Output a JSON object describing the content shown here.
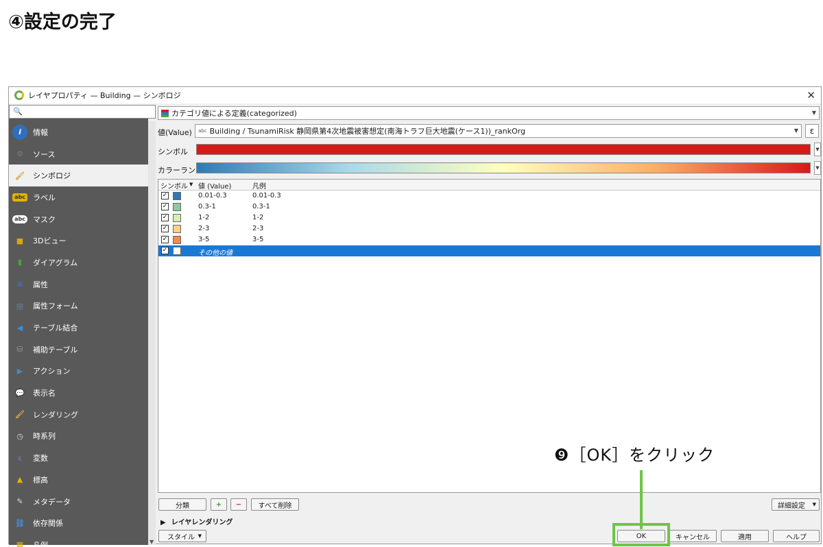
{
  "heading": "④設定の完了",
  "dialog": {
    "title": "レイヤプロパティ — Building — シンボロジ",
    "close": "✕"
  },
  "sidebar": {
    "search_icon": "🔍",
    "items": [
      {
        "label": "情報",
        "icon": "info-icon",
        "glyph": "i",
        "color": "#2e6fbf"
      },
      {
        "label": "ソース",
        "icon": "source-icon",
        "glyph": "⚙",
        "color": "#7a7a7a"
      },
      {
        "label": "シンボロジ",
        "icon": "paintbrush-icon",
        "glyph": "🖌",
        "color": "#d9a441"
      },
      {
        "label": "ラベル",
        "icon": "label-icon",
        "glyph": "abc",
        "color": "#e0b400"
      },
      {
        "label": "マスク",
        "icon": "mask-icon",
        "glyph": "abc",
        "color": "#333333"
      },
      {
        "label": "3Dビュー",
        "icon": "cube-icon",
        "glyph": "■",
        "color": "#d8a800"
      },
      {
        "label": "ダイアグラム",
        "icon": "diagram-icon",
        "glyph": "▮",
        "color": "#4aa33c"
      },
      {
        "label": "属性",
        "icon": "attributes-icon",
        "glyph": "≡",
        "color": "#3b72c6"
      },
      {
        "label": "属性フォーム",
        "icon": "form-icon",
        "glyph": "▤",
        "color": "#6a7ea0"
      },
      {
        "label": "テーブル結合",
        "icon": "join-icon",
        "glyph": "◀",
        "color": "#3a8de0"
      },
      {
        "label": "補助テーブル",
        "icon": "database-icon",
        "glyph": "⛁",
        "color": "#9a9a9a"
      },
      {
        "label": "アクション",
        "icon": "action-icon",
        "glyph": "▶",
        "color": "#4a86c8"
      },
      {
        "label": "表示名",
        "icon": "tooltip-icon",
        "glyph": "💬",
        "color": "#e8c340"
      },
      {
        "label": "レンダリング",
        "icon": "brush-icon",
        "glyph": "🖌",
        "color": "#d9a441"
      },
      {
        "label": "時系列",
        "icon": "clock-icon",
        "glyph": "◷",
        "color": "#dddddd"
      },
      {
        "label": "変数",
        "icon": "variable-icon",
        "glyph": "ε",
        "color": "#8a5ea8"
      },
      {
        "label": "標高",
        "icon": "elevation-icon",
        "glyph": "▲",
        "color": "#e0b400"
      },
      {
        "label": "メタデータ",
        "icon": "metadata-icon",
        "glyph": "✎",
        "color": "#dddddd"
      },
      {
        "label": "依存関係",
        "icon": "dependency-icon",
        "glyph": "⛓",
        "color": "#4a86c8"
      },
      {
        "label": "凡例",
        "icon": "legend-icon",
        "glyph": "▦",
        "color": "#e0b400"
      }
    ]
  },
  "renderer": {
    "value": "カテゴリ値による定義(categorized)",
    "icon": "categorized-icon"
  },
  "value_field": {
    "label": "値(Value)",
    "prefix": "abc",
    "value": "Building / TsunamiRisk 静岡県第4次地震被害想定(南海トラフ巨大地震(ケース1))_rankOrg",
    "expression_button": "ε"
  },
  "symbol_label": "シンボル",
  "colorramp_label": "カラーランプ",
  "symbol_color": "#d7191c",
  "table": {
    "headers": {
      "symbol": "シンボル",
      "value": "値 (Value)",
      "legend": "凡例"
    },
    "rows": [
      {
        "value": "0.01-0.3",
        "legend": "0.01-0.3",
        "color": "#2c7bb6"
      },
      {
        "value": "0.3-1",
        "legend": "0.3-1",
        "color": "#8dc8a4"
      },
      {
        "value": "1-2",
        "legend": "1-2",
        "color": "#d6eeb1"
      },
      {
        "value": "2-3",
        "legend": "2-3",
        "color": "#fdd08a"
      },
      {
        "value": "3-5",
        "legend": "3-5",
        "color": "#f48a52"
      },
      {
        "value": "その他の値",
        "legend": "",
        "color": "#ffffff"
      }
    ],
    "check": "✓"
  },
  "buttons": {
    "classify": "分類",
    "add": "+",
    "remove": "−",
    "remove_all": "すべて削除",
    "advanced": "詳細設定",
    "layer_rendering": "レイヤレンダリング",
    "style": "スタイル",
    "ok": "OK",
    "cancel": "キャンセル",
    "apply": "適用",
    "help": "ヘルプ"
  },
  "annotation": "❾［OK］をクリック",
  "colors": {
    "selection": "#1a78d4",
    "highlight": "#6cc644"
  }
}
